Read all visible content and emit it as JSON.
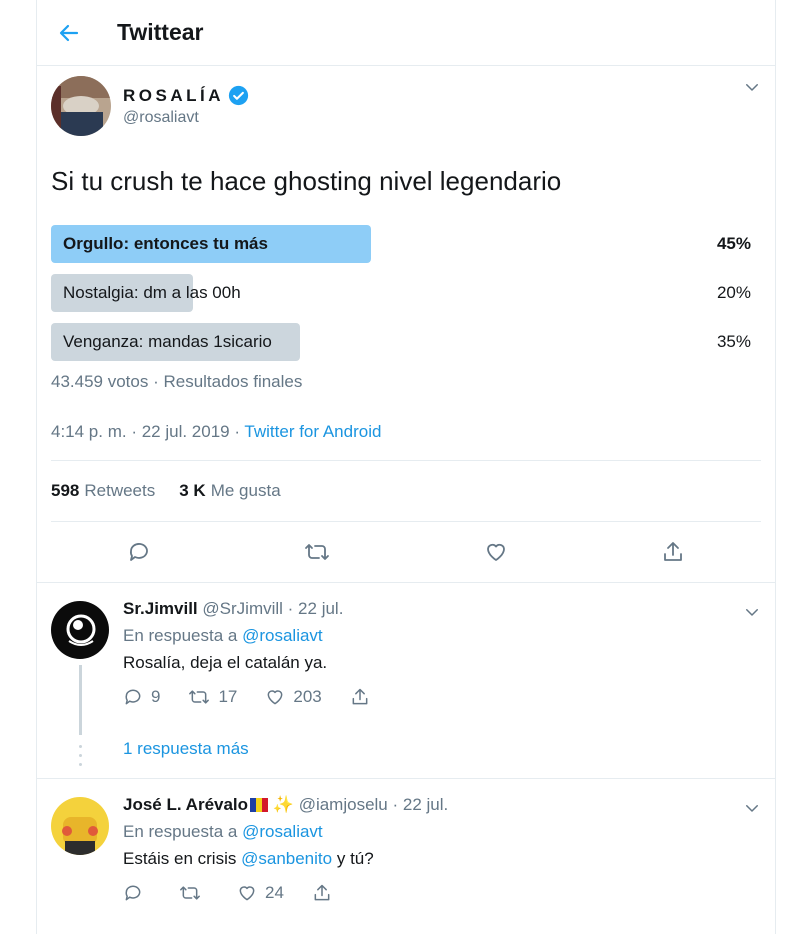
{
  "header": {
    "title": "Twittear"
  },
  "tweet": {
    "display_name": "ROSALÍA",
    "handle": "@rosaliavt",
    "text": "Si tu crush te hace ghosting nivel legendario",
    "poll": {
      "options": [
        {
          "label": "Orgullo: entonces tu más",
          "percent": "45%",
          "fraction": 0.45,
          "winner": true
        },
        {
          "label": "Nostalgia: dm a las 00h",
          "percent": "20%",
          "fraction": 0.2,
          "winner": false
        },
        {
          "label": "Venganza: mandas 1sicario",
          "percent": "35%",
          "fraction": 0.35,
          "winner": false
        }
      ],
      "votes_text": "43.459 votos · Resultados finales"
    },
    "timestamp": "4:14 p. m. · 22 jul. 2019 ·",
    "source": "Twitter for Android",
    "retweets_count": "598",
    "retweets_label": "Retweets",
    "likes_count": "3 K",
    "likes_label": "Me gusta"
  },
  "replies": [
    {
      "name": "Sr.Jimvill",
      "handle": "@SrJimvill",
      "date": "· 22 jul.",
      "in_reply_prefix": "En respuesta a",
      "in_reply_handle": "@rosaliavt",
      "text": "Rosalía, deja el catalán ya.",
      "reply_count": "9",
      "retweet_count": "17",
      "like_count": "203",
      "more_replies": "1 respuesta más"
    },
    {
      "name": "José L. Arévalo",
      "name_emojis": "✨",
      "handle": "@iamjoselu",
      "date": "· 22 jul.",
      "in_reply_prefix": "En respuesta a",
      "in_reply_handle": "@rosaliavt",
      "text_before": "Estáis en crisis",
      "text_mention": "@sanbenito",
      "text_after": "y tú?",
      "reply_count": "",
      "retweet_count": "",
      "like_count": "24"
    }
  ],
  "colors": {
    "accent": "#1da1f2",
    "winner_bar": "#8ecdf7",
    "loser_bar": "#ccd6dd",
    "muted": "#657786"
  }
}
